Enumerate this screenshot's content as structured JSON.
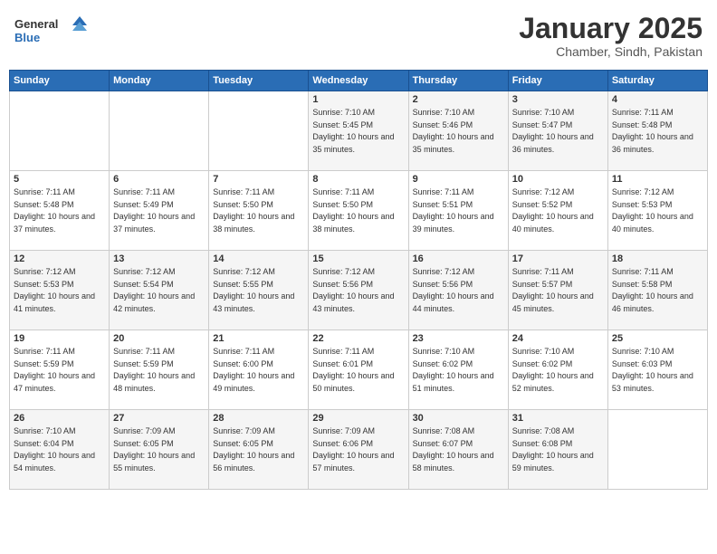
{
  "header": {
    "logo_line1": "General",
    "logo_line2": "Blue",
    "month": "January 2025",
    "location": "Chamber, Sindh, Pakistan"
  },
  "weekdays": [
    "Sunday",
    "Monday",
    "Tuesday",
    "Wednesday",
    "Thursday",
    "Friday",
    "Saturday"
  ],
  "weeks": [
    [
      {
        "day": "",
        "sunrise": "",
        "sunset": "",
        "daylight": ""
      },
      {
        "day": "",
        "sunrise": "",
        "sunset": "",
        "daylight": ""
      },
      {
        "day": "",
        "sunrise": "",
        "sunset": "",
        "daylight": ""
      },
      {
        "day": "1",
        "sunrise": "Sunrise: 7:10 AM",
        "sunset": "Sunset: 5:45 PM",
        "daylight": "Daylight: 10 hours and 35 minutes."
      },
      {
        "day": "2",
        "sunrise": "Sunrise: 7:10 AM",
        "sunset": "Sunset: 5:46 PM",
        "daylight": "Daylight: 10 hours and 35 minutes."
      },
      {
        "day": "3",
        "sunrise": "Sunrise: 7:10 AM",
        "sunset": "Sunset: 5:47 PM",
        "daylight": "Daylight: 10 hours and 36 minutes."
      },
      {
        "day": "4",
        "sunrise": "Sunrise: 7:11 AM",
        "sunset": "Sunset: 5:48 PM",
        "daylight": "Daylight: 10 hours and 36 minutes."
      }
    ],
    [
      {
        "day": "5",
        "sunrise": "Sunrise: 7:11 AM",
        "sunset": "Sunset: 5:48 PM",
        "daylight": "Daylight: 10 hours and 37 minutes."
      },
      {
        "day": "6",
        "sunrise": "Sunrise: 7:11 AM",
        "sunset": "Sunset: 5:49 PM",
        "daylight": "Daylight: 10 hours and 37 minutes."
      },
      {
        "day": "7",
        "sunrise": "Sunrise: 7:11 AM",
        "sunset": "Sunset: 5:50 PM",
        "daylight": "Daylight: 10 hours and 38 minutes."
      },
      {
        "day": "8",
        "sunrise": "Sunrise: 7:11 AM",
        "sunset": "Sunset: 5:50 PM",
        "daylight": "Daylight: 10 hours and 38 minutes."
      },
      {
        "day": "9",
        "sunrise": "Sunrise: 7:11 AM",
        "sunset": "Sunset: 5:51 PM",
        "daylight": "Daylight: 10 hours and 39 minutes."
      },
      {
        "day": "10",
        "sunrise": "Sunrise: 7:12 AM",
        "sunset": "Sunset: 5:52 PM",
        "daylight": "Daylight: 10 hours and 40 minutes."
      },
      {
        "day": "11",
        "sunrise": "Sunrise: 7:12 AM",
        "sunset": "Sunset: 5:53 PM",
        "daylight": "Daylight: 10 hours and 40 minutes."
      }
    ],
    [
      {
        "day": "12",
        "sunrise": "Sunrise: 7:12 AM",
        "sunset": "Sunset: 5:53 PM",
        "daylight": "Daylight: 10 hours and 41 minutes."
      },
      {
        "day": "13",
        "sunrise": "Sunrise: 7:12 AM",
        "sunset": "Sunset: 5:54 PM",
        "daylight": "Daylight: 10 hours and 42 minutes."
      },
      {
        "day": "14",
        "sunrise": "Sunrise: 7:12 AM",
        "sunset": "Sunset: 5:55 PM",
        "daylight": "Daylight: 10 hours and 43 minutes."
      },
      {
        "day": "15",
        "sunrise": "Sunrise: 7:12 AM",
        "sunset": "Sunset: 5:56 PM",
        "daylight": "Daylight: 10 hours and 43 minutes."
      },
      {
        "day": "16",
        "sunrise": "Sunrise: 7:12 AM",
        "sunset": "Sunset: 5:56 PM",
        "daylight": "Daylight: 10 hours and 44 minutes."
      },
      {
        "day": "17",
        "sunrise": "Sunrise: 7:11 AM",
        "sunset": "Sunset: 5:57 PM",
        "daylight": "Daylight: 10 hours and 45 minutes."
      },
      {
        "day": "18",
        "sunrise": "Sunrise: 7:11 AM",
        "sunset": "Sunset: 5:58 PM",
        "daylight": "Daylight: 10 hours and 46 minutes."
      }
    ],
    [
      {
        "day": "19",
        "sunrise": "Sunrise: 7:11 AM",
        "sunset": "Sunset: 5:59 PM",
        "daylight": "Daylight: 10 hours and 47 minutes."
      },
      {
        "day": "20",
        "sunrise": "Sunrise: 7:11 AM",
        "sunset": "Sunset: 5:59 PM",
        "daylight": "Daylight: 10 hours and 48 minutes."
      },
      {
        "day": "21",
        "sunrise": "Sunrise: 7:11 AM",
        "sunset": "Sunset: 6:00 PM",
        "daylight": "Daylight: 10 hours and 49 minutes."
      },
      {
        "day": "22",
        "sunrise": "Sunrise: 7:11 AM",
        "sunset": "Sunset: 6:01 PM",
        "daylight": "Daylight: 10 hours and 50 minutes."
      },
      {
        "day": "23",
        "sunrise": "Sunrise: 7:10 AM",
        "sunset": "Sunset: 6:02 PM",
        "daylight": "Daylight: 10 hours and 51 minutes."
      },
      {
        "day": "24",
        "sunrise": "Sunrise: 7:10 AM",
        "sunset": "Sunset: 6:02 PM",
        "daylight": "Daylight: 10 hours and 52 minutes."
      },
      {
        "day": "25",
        "sunrise": "Sunrise: 7:10 AM",
        "sunset": "Sunset: 6:03 PM",
        "daylight": "Daylight: 10 hours and 53 minutes."
      }
    ],
    [
      {
        "day": "26",
        "sunrise": "Sunrise: 7:10 AM",
        "sunset": "Sunset: 6:04 PM",
        "daylight": "Daylight: 10 hours and 54 minutes."
      },
      {
        "day": "27",
        "sunrise": "Sunrise: 7:09 AM",
        "sunset": "Sunset: 6:05 PM",
        "daylight": "Daylight: 10 hours and 55 minutes."
      },
      {
        "day": "28",
        "sunrise": "Sunrise: 7:09 AM",
        "sunset": "Sunset: 6:05 PM",
        "daylight": "Daylight: 10 hours and 56 minutes."
      },
      {
        "day": "29",
        "sunrise": "Sunrise: 7:09 AM",
        "sunset": "Sunset: 6:06 PM",
        "daylight": "Daylight: 10 hours and 57 minutes."
      },
      {
        "day": "30",
        "sunrise": "Sunrise: 7:08 AM",
        "sunset": "Sunset: 6:07 PM",
        "daylight": "Daylight: 10 hours and 58 minutes."
      },
      {
        "day": "31",
        "sunrise": "Sunrise: 7:08 AM",
        "sunset": "Sunset: 6:08 PM",
        "daylight": "Daylight: 10 hours and 59 minutes."
      },
      {
        "day": "",
        "sunrise": "",
        "sunset": "",
        "daylight": ""
      }
    ]
  ]
}
